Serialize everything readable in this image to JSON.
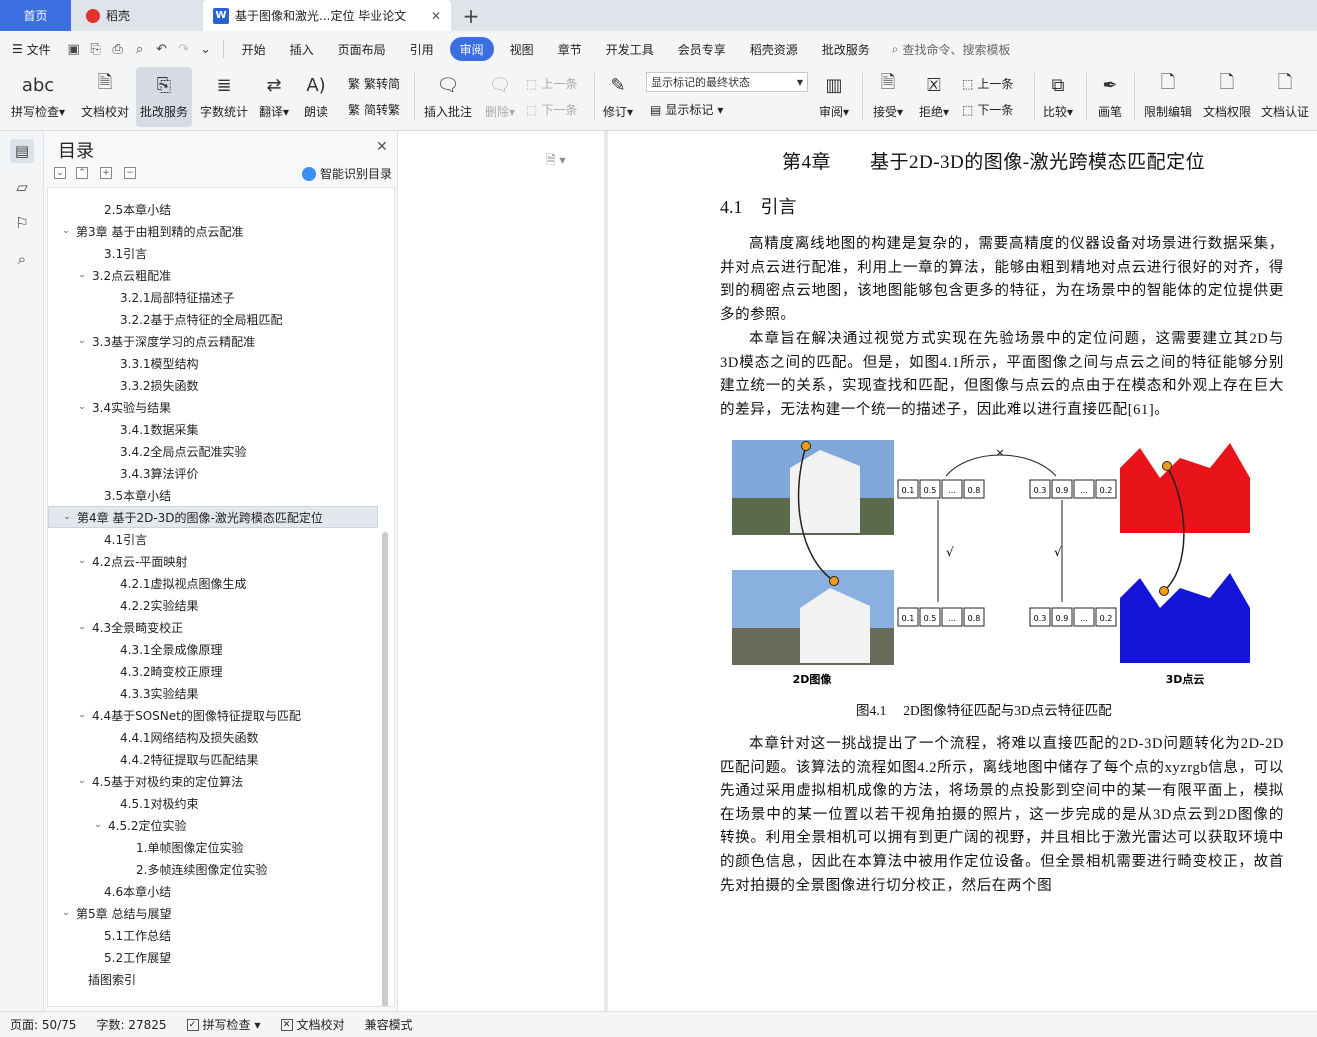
{
  "tabs": {
    "home": "首页",
    "docer": "稻壳",
    "doc": "基于图像和激光...定位 毕业论文"
  },
  "menu": {
    "file": "文件",
    "items": [
      "开始",
      "插入",
      "页面布局",
      "引用",
      "审阅",
      "视图",
      "章节",
      "开发工具",
      "会员专享",
      "稻壳资源",
      "批改服务"
    ],
    "active": "审阅",
    "search": "查找命令、搜索模板"
  },
  "ribbon": {
    "spell": "拼写检查",
    "doccheck": "文档校对",
    "review_service": "批改服务",
    "wordcount": "字数统计",
    "translate": "翻译",
    "read": "朗读",
    "to_trad": "繁转简",
    "to_simp": "简转繁",
    "insert_comment": "插入批注",
    "delete": "删除",
    "prev": "上一条",
    "next": "下一条",
    "revise": "修订",
    "markup_state": "显示标记的最终状态",
    "show_markup": "显示标记",
    "review": "审阅",
    "accept": "接受",
    "reject": "拒绝",
    "prev2": "上一条",
    "next2": "下一条",
    "compare": "比较",
    "pen": "画笔",
    "restrict": "限制编辑",
    "doc_perm": "文档权限",
    "doc_cert": "文档认证"
  },
  "toc": {
    "title": "目录",
    "smart": "智能识别目录",
    "items": [
      {
        "t": "2.5本章小结",
        "lv": 2
      },
      {
        "t": "第3章 基于由粗到精的点云配准",
        "lv": 1,
        "exp": true
      },
      {
        "t": "3.1引言",
        "lv": 2
      },
      {
        "t": "3.2点云粗配准",
        "lv": 2,
        "exp": true
      },
      {
        "t": "3.2.1局部特征描述子",
        "lv": 3
      },
      {
        "t": "3.2.2基于点特征的全局粗匹配",
        "lv": 3
      },
      {
        "t": "3.3基于深度学习的点云精配准",
        "lv": 2,
        "exp": true
      },
      {
        "t": "3.3.1模型结构",
        "lv": 3
      },
      {
        "t": "3.3.2损失函数",
        "lv": 3
      },
      {
        "t": "3.4实验与结果",
        "lv": 2,
        "exp": true
      },
      {
        "t": "3.4.1数据采集",
        "lv": 3
      },
      {
        "t": "3.4.2全局点云配准实验",
        "lv": 3
      },
      {
        "t": "3.4.3算法评价",
        "lv": 3
      },
      {
        "t": "3.5本章小结",
        "lv": 2
      },
      {
        "t": "第4章 基于2D-3D的图像-激光跨模态匹配定位",
        "lv": 1,
        "exp": true,
        "sel": true
      },
      {
        "t": "4.1引言",
        "lv": 2
      },
      {
        "t": "4.2点云-平面映射",
        "lv": 2,
        "exp": true
      },
      {
        "t": "4.2.1虚拟视点图像生成",
        "lv": 3
      },
      {
        "t": "4.2.2实验结果",
        "lv": 3
      },
      {
        "t": "4.3全景畸变校正",
        "lv": 2,
        "exp": true
      },
      {
        "t": "4.3.1全景成像原理",
        "lv": 3
      },
      {
        "t": "4.3.2畸变校正原理",
        "lv": 3
      },
      {
        "t": "4.3.3实验结果",
        "lv": 3
      },
      {
        "t": "4.4基于SOSNet的图像特征提取与匹配",
        "lv": 2,
        "exp": true
      },
      {
        "t": "4.4.1网络结构及损失函数",
        "lv": 3
      },
      {
        "t": "4.4.2特征提取与匹配结果",
        "lv": 3
      },
      {
        "t": "4.5基于对极约束的定位算法",
        "lv": 2,
        "exp": true
      },
      {
        "t": "4.5.1对极约束",
        "lv": 3
      },
      {
        "t": "4.5.2定位实验",
        "lv": 3,
        "exp": true
      },
      {
        "t": "1.单帧图像定位实验",
        "lv": 4
      },
      {
        "t": "2.多帧连续图像定位实验",
        "lv": 4
      },
      {
        "t": "4.6本章小结",
        "lv": 2
      },
      {
        "t": "第5章 总结与展望",
        "lv": 1,
        "exp": true
      },
      {
        "t": "5.1工作总结",
        "lv": 2
      },
      {
        "t": "5.2工作展望",
        "lv": 2
      },
      {
        "t": "插图索引",
        "lv": 1
      }
    ]
  },
  "doc": {
    "chapter": "第4章　　基于2D-3D的图像-激光跨模态匹配定位",
    "section": "4.1　引言",
    "p1": "高精度离线地图的构建是复杂的，需要高精度的仪器设备对场景进行数据采集，并对点云进行配准，利用上一章的算法，能够由粗到精地对点云进行很好的对齐，得到的稠密点云地图，该地图能够包含更多的特征，为在场景中的智能体的定位提供更多的参照。",
    "p2": "本章旨在解决通过视觉方式实现在先验场景中的定位问题，这需要建立其2D与3D模态之间的匹配。但是，如图4.1所示，平面图像之间与点云之间的特征能够分别建立统一的关系，实现查找和匹配，但图像与点云的点由于在模态和外观上存在巨大的差异，无法构建一个统一的描述子，因此难以进行直接匹配[61]。",
    "p3": "本章针对这一挑战提出了一个流程，将难以直接匹配的2D-3D问题转化为2D-2D匹配问题。该算法的流程如图4.2所示，离线地图中储存了每个点的xyzrgb信息，可以先通过采用虚拟相机成像的方法，将场景的点投影到空间中的某一有限平面上，模拟在场景中的某一位置以若干视角拍摄的照片，这一步完成的是从3D点云到2D图像的转换。利用全景相机可以拥有到更广阔的视野，并且相比于激光雷达可以获取环境中的颜色信息，因此在本算法中被用作定位设备。但全景相机需要进行畸变校正，故首先对拍摄的全景图像进行切分校正，然后在两个图",
    "caption": "图4.1　 2D图像特征匹配与3D点云特征匹配",
    "fig": {
      "label_2d": "2D图像",
      "label_3d": "3D点云",
      "vec_a": [
        "0.1",
        "0.5",
        "...",
        "0.8"
      ],
      "vec_b": [
        "0.3",
        "0.9",
        "...",
        "0.2"
      ],
      "cross": "×",
      "check": "√"
    }
  },
  "status": {
    "page": "页面: 50/75",
    "words": "字数: 27825",
    "spell": "拼写检查",
    "check": "文档校对",
    "compat": "兼容模式"
  }
}
